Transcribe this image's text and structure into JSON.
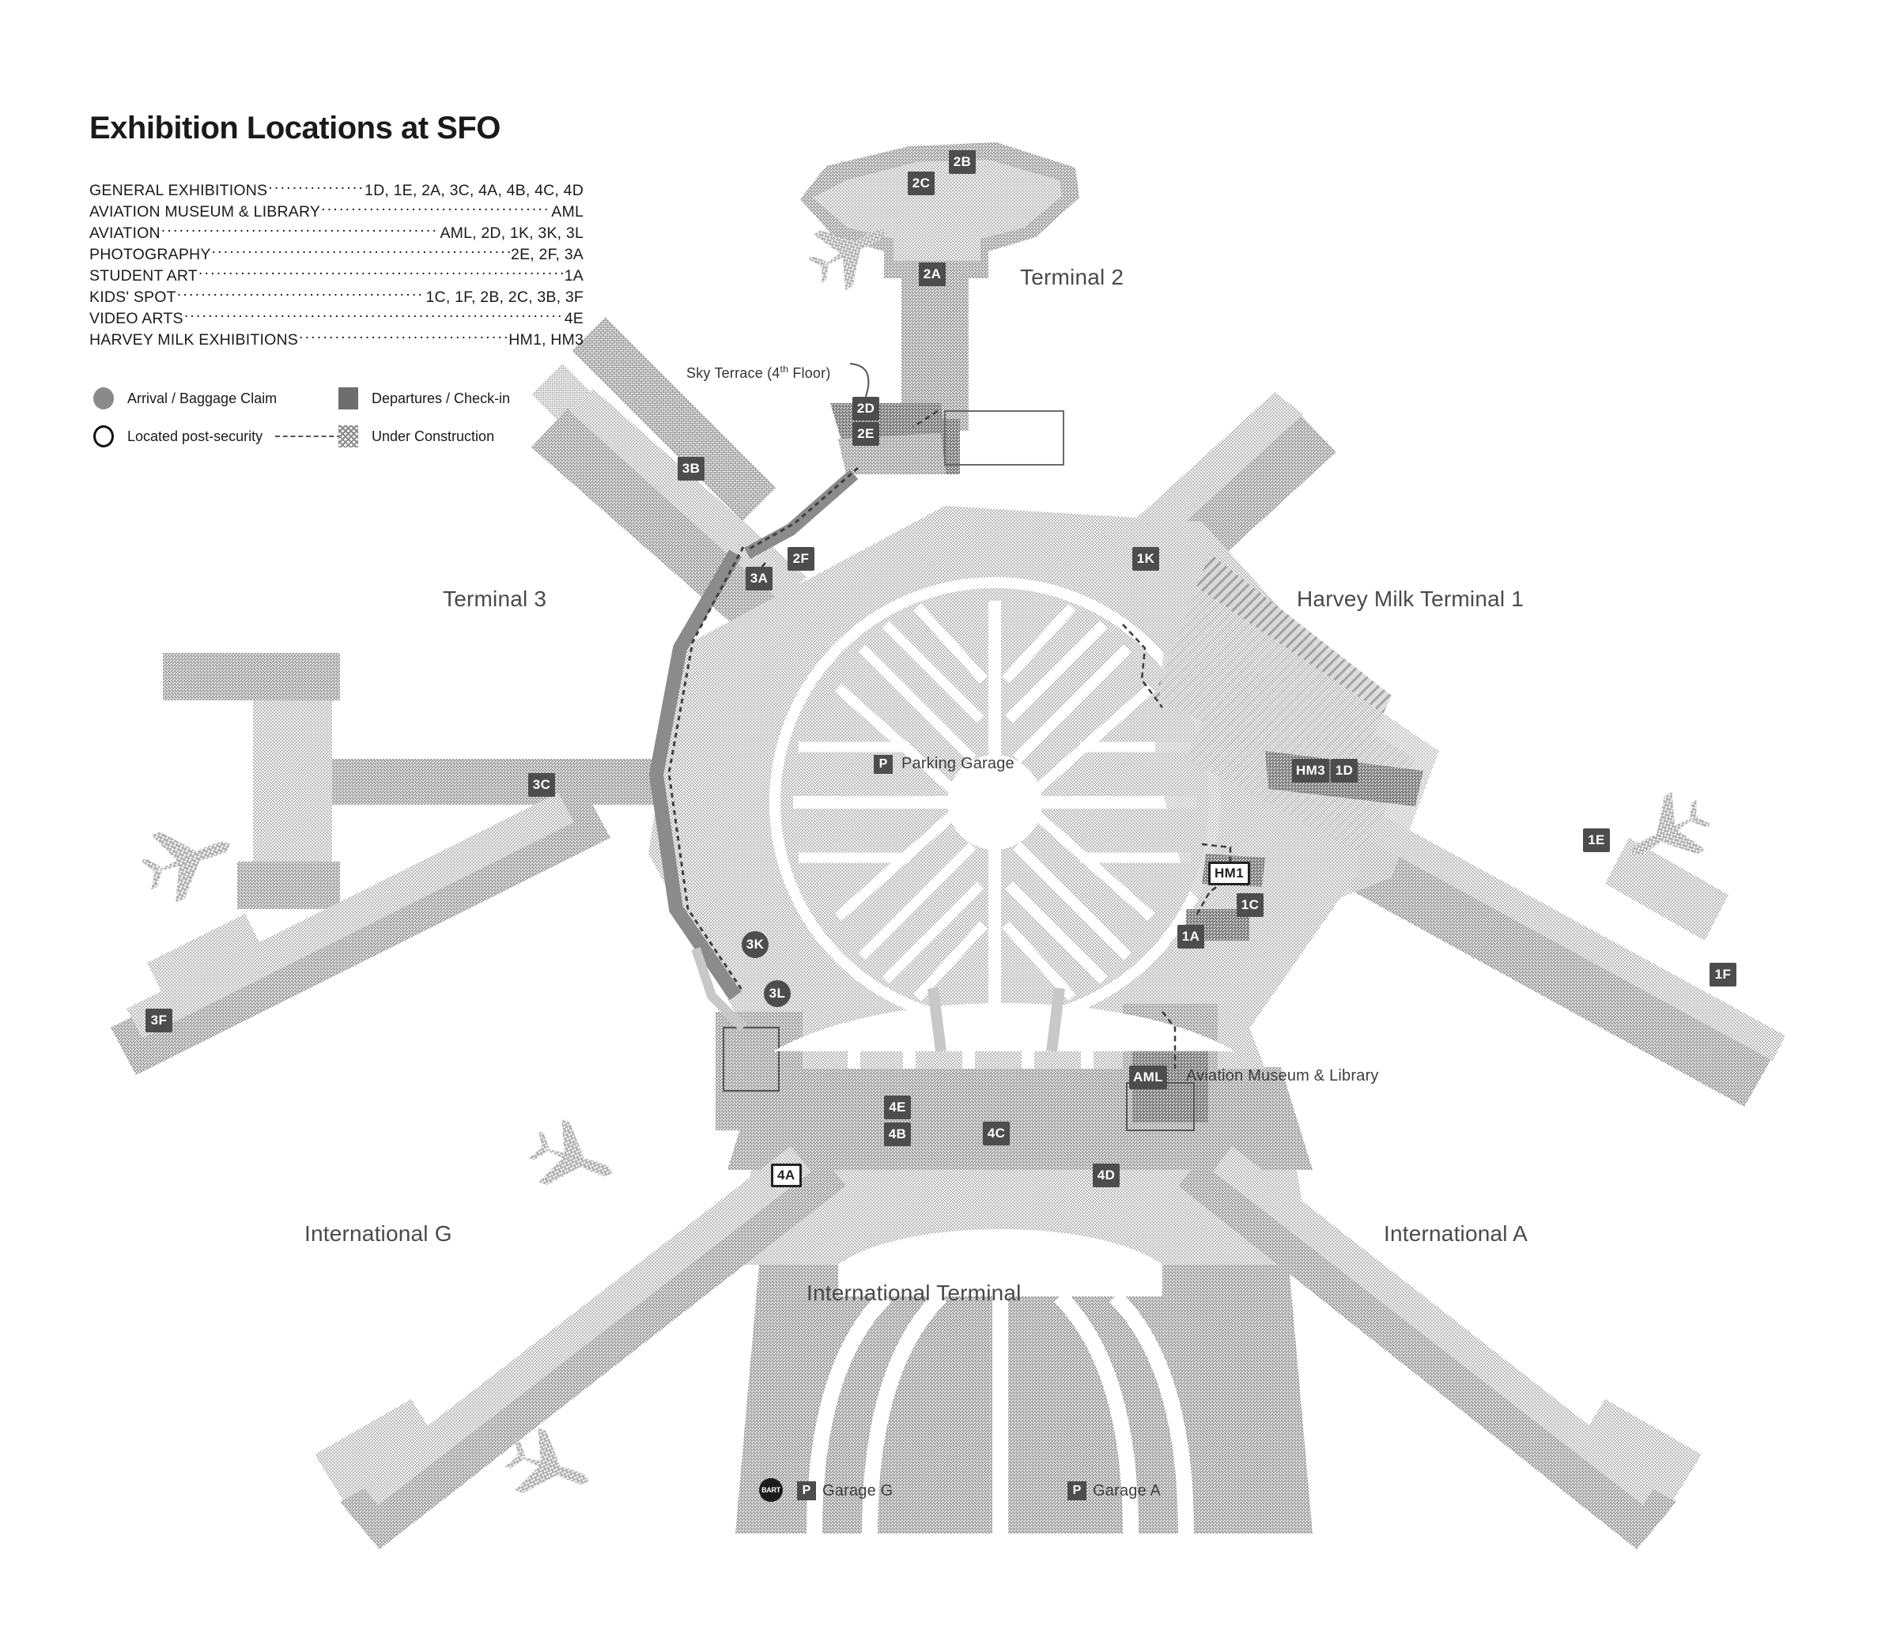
{
  "title": "Exhibition Locations at SFO",
  "exhibitions": [
    {
      "name": "GENERAL EXHIBITIONS",
      "locations": "1D, 1E, 2A, 3C, 4A, 4B, 4C, 4D"
    },
    {
      "name": "AVIATION MUSEUM & LIBRARY",
      "locations": "AML"
    },
    {
      "name": "AVIATION",
      "locations": "AML, 2D, 1K, 3K, 3L"
    },
    {
      "name": "PHOTOGRAPHY",
      "locations": "2E, 2F, 3A"
    },
    {
      "name": "STUDENT ART",
      "locations": "1A"
    },
    {
      "name": "KIDS' SPOT",
      "locations": "1C, 1F, 2B, 2C, 3B, 3F"
    },
    {
      "name": "VIDEO ARTS",
      "locations": "4E"
    },
    {
      "name": "HARVEY MILK EXHIBITIONS",
      "locations": "HM1, HM3"
    }
  ],
  "key": {
    "arrival_label": "Arrival / Baggage Claim",
    "departures_label": "Departures / Check-in",
    "post_security_label": "Located post-security",
    "under_construction_label": "Under Construction"
  },
  "terminals": [
    {
      "id": "t2",
      "label": "Terminal 2"
    },
    {
      "id": "t3",
      "label": "Terminal 3"
    },
    {
      "id": "hm1",
      "label": "Harvey Milk Terminal 1"
    },
    {
      "id": "intl_g",
      "label": "International G"
    },
    {
      "id": "intl_a",
      "label": "International A"
    },
    {
      "id": "intl_terminal",
      "label": "International Terminal"
    }
  ],
  "annotations": {
    "sky_terrace": "Sky Terrace (4th Floor)",
    "aviation_museum": "Aviation Museum & Library",
    "parking_garage": "Parking Garage",
    "garage_g": "Garage G",
    "garage_a": "Garage A",
    "p_symbol": "P",
    "bart_symbol": "BART"
  },
  "markers": [
    {
      "id": "2B",
      "label": "2B",
      "style": "filled"
    },
    {
      "id": "2C",
      "label": "2C",
      "style": "filled"
    },
    {
      "id": "2A",
      "label": "2A",
      "style": "filled"
    },
    {
      "id": "2D",
      "label": "2D",
      "style": "filled"
    },
    {
      "id": "2E",
      "label": "2E",
      "style": "filled"
    },
    {
      "id": "3B",
      "label": "3B",
      "style": "filled"
    },
    {
      "id": "3A",
      "label": "3A",
      "style": "filled"
    },
    {
      "id": "2F",
      "label": "2F",
      "style": "filled"
    },
    {
      "id": "1K",
      "label": "1K",
      "style": "filled"
    },
    {
      "id": "3C",
      "label": "3C",
      "style": "filled"
    },
    {
      "id": "HM3",
      "label": "HM3",
      "style": "filled"
    },
    {
      "id": "1D",
      "label": "1D",
      "style": "filled"
    },
    {
      "id": "1E",
      "label": "1E",
      "style": "filled"
    },
    {
      "id": "HM1",
      "label": "HM1",
      "style": "open"
    },
    {
      "id": "1C",
      "label": "1C",
      "style": "filled"
    },
    {
      "id": "1A",
      "label": "1A",
      "style": "filled"
    },
    {
      "id": "3K",
      "label": "3K",
      "style": "round"
    },
    {
      "id": "3L",
      "label": "3L",
      "style": "round"
    },
    {
      "id": "1F",
      "label": "1F",
      "style": "filled"
    },
    {
      "id": "3F",
      "label": "3F",
      "style": "filled"
    },
    {
      "id": "AML",
      "label": "AML",
      "style": "filled"
    },
    {
      "id": "4E",
      "label": "4E",
      "style": "filled"
    },
    {
      "id": "4B",
      "label": "4B",
      "style": "filled"
    },
    {
      "id": "4C",
      "label": "4C",
      "style": "filled"
    },
    {
      "id": "4A",
      "label": "4A",
      "style": "open"
    },
    {
      "id": "4D",
      "label": "4D",
      "style": "filled"
    }
  ],
  "colors": {
    "terminal_fill": "#d4d4d4",
    "secure_fill": "#bdbdbd",
    "departures": "#6e6e6e",
    "marker_bg": "#4d4d4d",
    "text": "#1a1a1a",
    "map_label": "#4a4a4a"
  }
}
